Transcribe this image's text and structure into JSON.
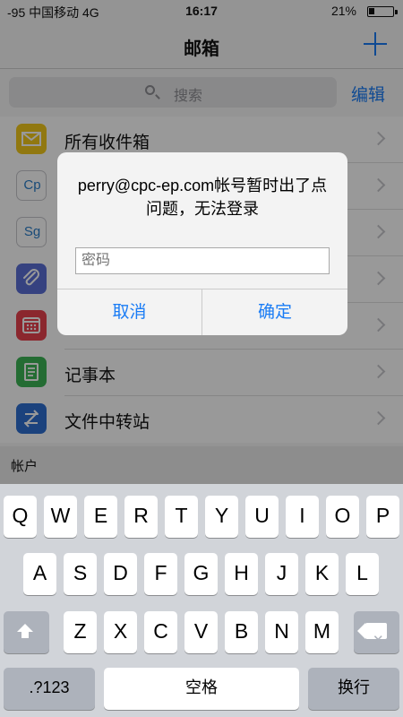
{
  "status_bar": {
    "carrier": "-95 中国移动  4G",
    "time": "16:17",
    "battery": "21%"
  },
  "nav": {
    "title": "邮箱",
    "add_icon": "plus-icon"
  },
  "search": {
    "placeholder": "搜索",
    "edit_label": "编辑"
  },
  "mailboxes": [
    {
      "label": "所有收件箱",
      "icon": "envelope-icon",
      "color": "#f2c81b"
    },
    {
      "label": "",
      "icon": "Cp",
      "color": "#2a7dc9"
    },
    {
      "label": "",
      "icon": "Sg",
      "color": "#2a7dc9"
    },
    {
      "label": "",
      "icon": "paperclip-icon",
      "color": "#5b6fd6"
    },
    {
      "label": "",
      "icon": "calendar-icon",
      "color": "#e8414e"
    },
    {
      "label": "记事本",
      "icon": "notes-icon",
      "color": "#3cb556"
    },
    {
      "label": "文件中转站",
      "icon": "transfer-icon",
      "color": "#2e6fd1"
    }
  ],
  "section": {
    "accounts": "帐户"
  },
  "alert": {
    "message": "perry@cpc-ep.com帐号暂时出了点问题，无法登录",
    "password_placeholder": "密码",
    "cancel": "取消",
    "ok": "确定"
  },
  "keyboard": {
    "row1": [
      "Q",
      "W",
      "E",
      "R",
      "T",
      "Y",
      "U",
      "I",
      "O",
      "P"
    ],
    "row2": [
      "A",
      "S",
      "D",
      "F",
      "G",
      "H",
      "J",
      "K",
      "L"
    ],
    "row3": [
      "Z",
      "X",
      "C",
      "V",
      "B",
      "N",
      "M"
    ],
    "numbers": ".?123",
    "space": "空格",
    "return": "换行"
  },
  "colors": {
    "accent": "#1a7cf5"
  }
}
